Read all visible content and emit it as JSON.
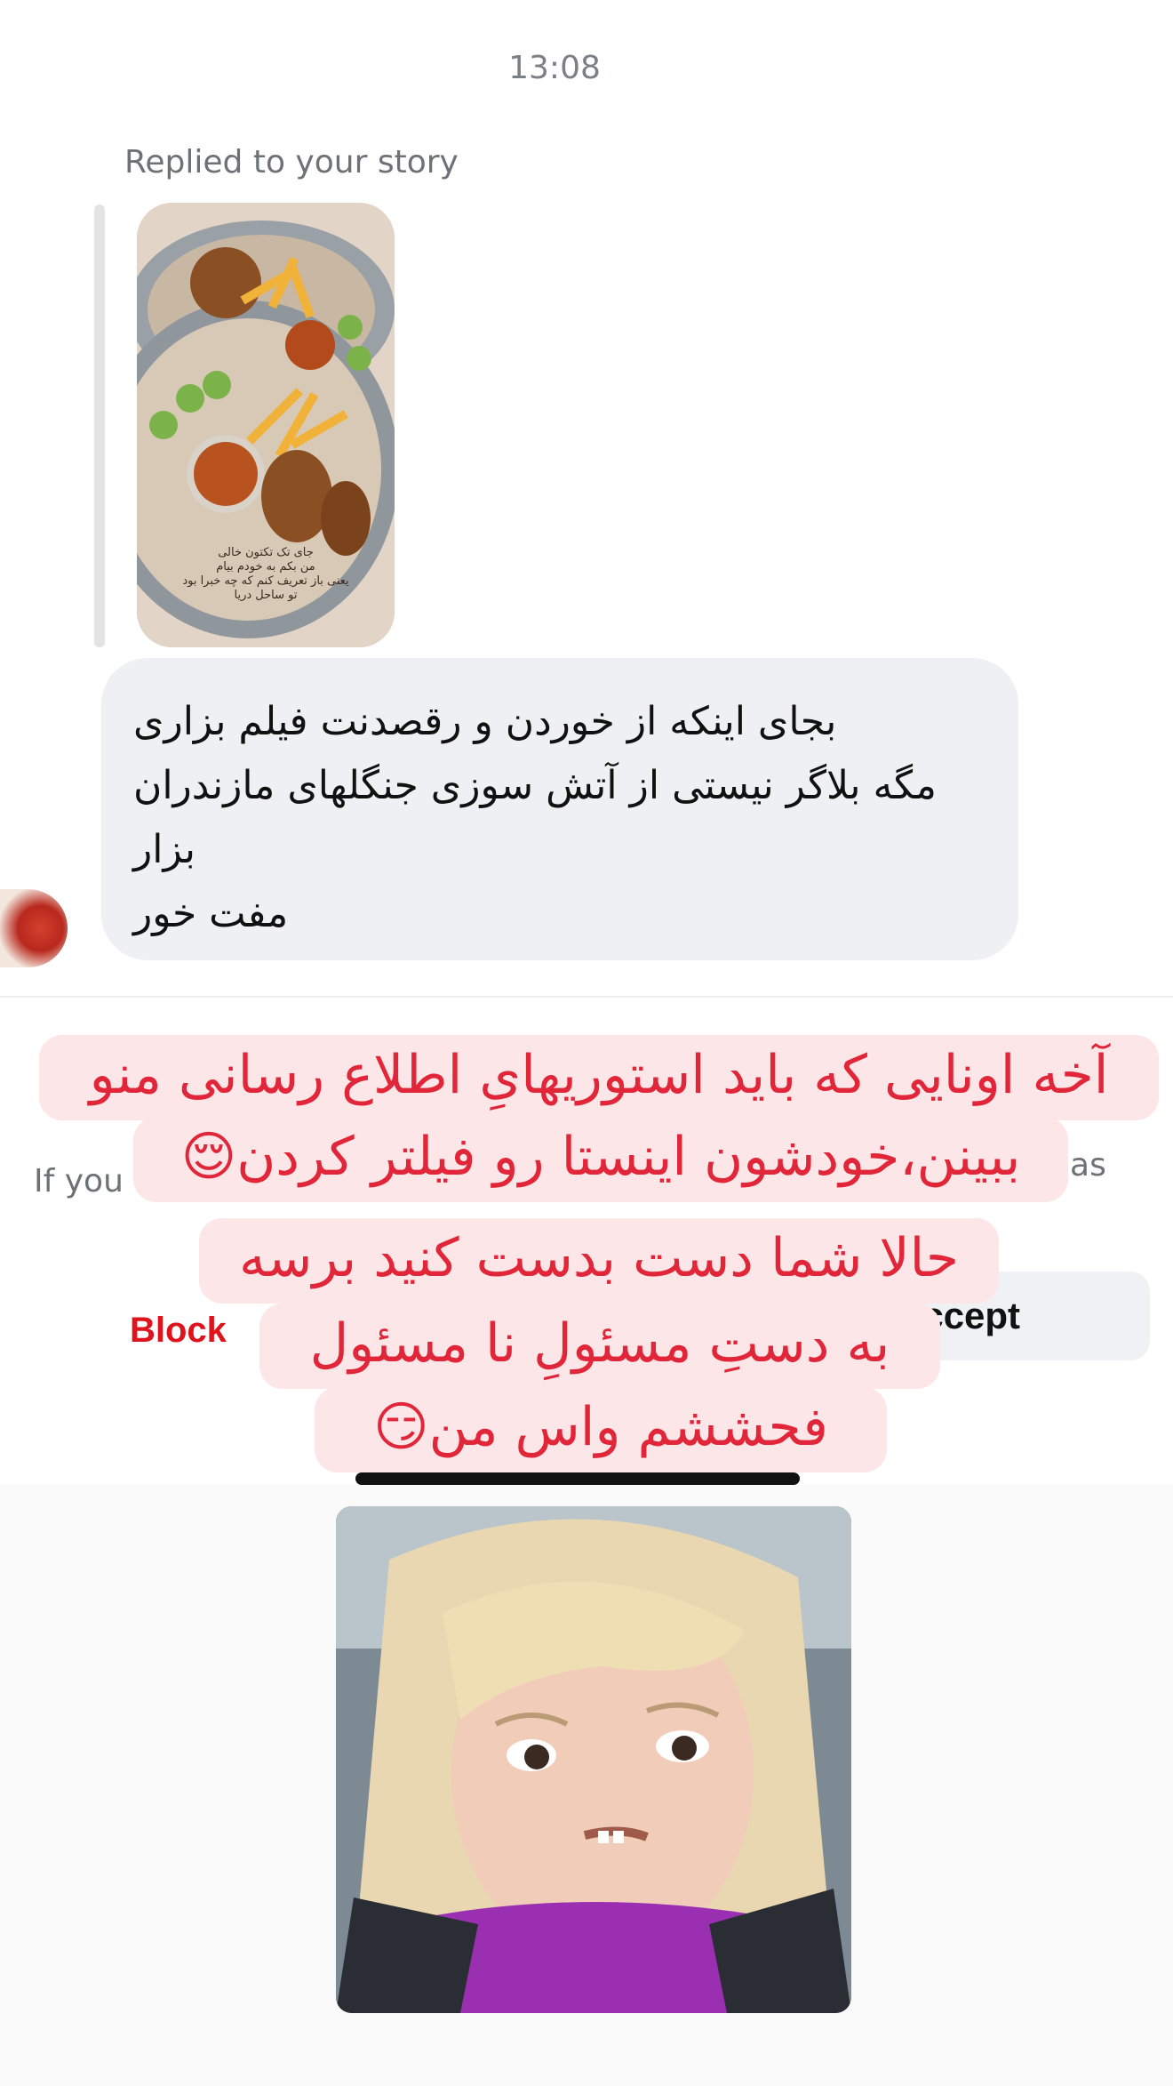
{
  "thread": {
    "timestamp": "13:08",
    "replied_label": "Replied to your story",
    "story_caption": "جای تک تکتون خالی\nمن بکم به خودم بیام\nیعنی باز تعریف کنم که چه خبرا بود\nتو ساحل دریا",
    "message_text": "بجای اینکه از خوردن و رقصدنت فیلم بزاری\nمگه بلاگر نیستی از آتش سوزی جنگلهای مازندران\nبزار\nمفت خور"
  },
  "request": {
    "left_text": "If you",
    "right_text": "ch as",
    "block_label": "Block",
    "accept_label": "Accept"
  },
  "overlay": {
    "line1": "آخه اونایی که باید استوریهایِ اطلاع رسانی منو",
    "line2": "ببینن،خودشون اینستا رو فیلتر کردن😌",
    "line3": "حالا شما دست بدست کنید برسه",
    "line4": "به دستِ مسئولِ نا مسئول",
    "line5": "فحششم واس من😏"
  },
  "colors": {
    "overlay_text": "#e2263a",
    "overlay_bg": "#fde6e7",
    "block_red": "#e0121c",
    "bubble_bg": "#eef0f3"
  }
}
